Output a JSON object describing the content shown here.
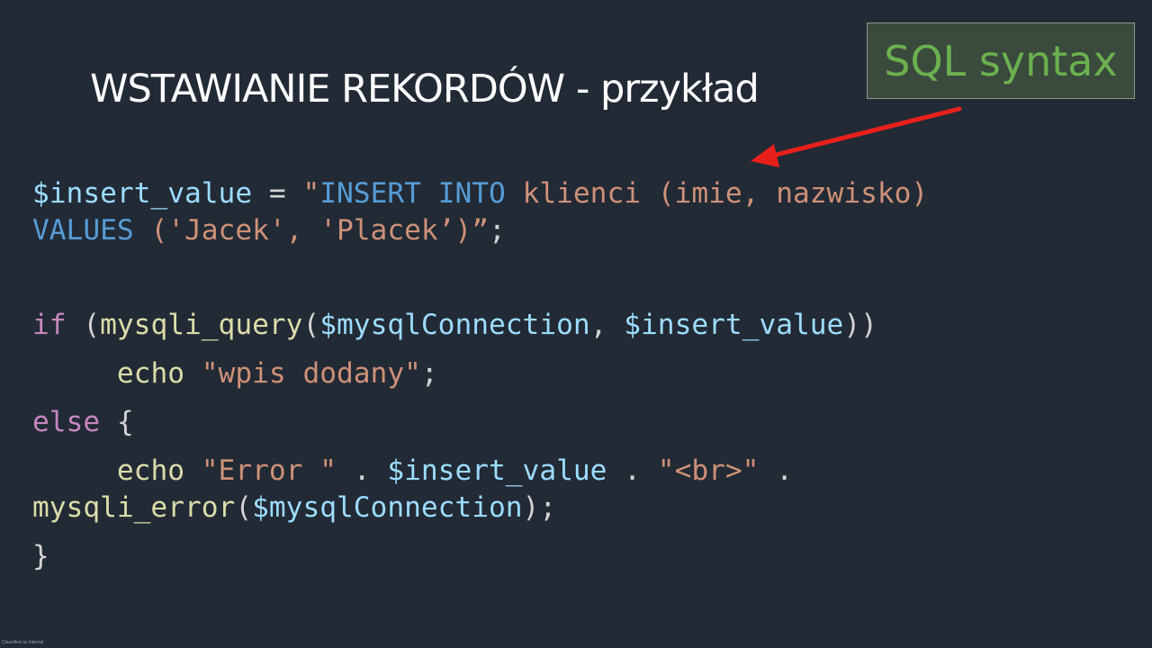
{
  "slide": {
    "title": "WSTAWIANIE REKORDÓW - przykład",
    "callout": "SQL syntax",
    "footer": "Classified as Internal"
  },
  "code": {
    "line1": {
      "var": "$insert_value",
      "eq": " = ",
      "q_open": "\"",
      "kw1": "INSERT",
      "sp1": " ",
      "kw2": "INTO",
      "rest": " klienci (imie, nazwisko)"
    },
    "line2": {
      "kw": "VALUES",
      "rest": " ('Jacek', 'Placek’)”",
      "semi": ";"
    },
    "line3": {
      "kw": "if",
      "open": " (",
      "fn": "mysqli_query",
      "paren": "(",
      "var1": "$mysqlConnection",
      "comma": ", ",
      "var2": "$insert_value",
      "close": "))"
    },
    "line4": {
      "indent": "    ",
      "fn": "echo",
      "sp": " ",
      "str": "\"wpis dodany\"",
      "semi": ";"
    },
    "line5": {
      "kw": "else",
      "brace": " {"
    },
    "line6": {
      "indent": "    ",
      "fn": "echo",
      "sp": " ",
      "str1": "\"Error \"",
      "dot1": " . ",
      "var": "$insert_value",
      "dot2": " . ",
      "str2": "\"<br>\"",
      "dot3": " ."
    },
    "line7": {
      "fn": "mysqli_error",
      "paren": "(",
      "var": "$mysqlConnection",
      "close": ");"
    },
    "line8": {
      "brace": "}"
    }
  },
  "colors": {
    "background": "#222a35",
    "callout_text": "#6bb14f",
    "arrow": "#e8201c"
  }
}
